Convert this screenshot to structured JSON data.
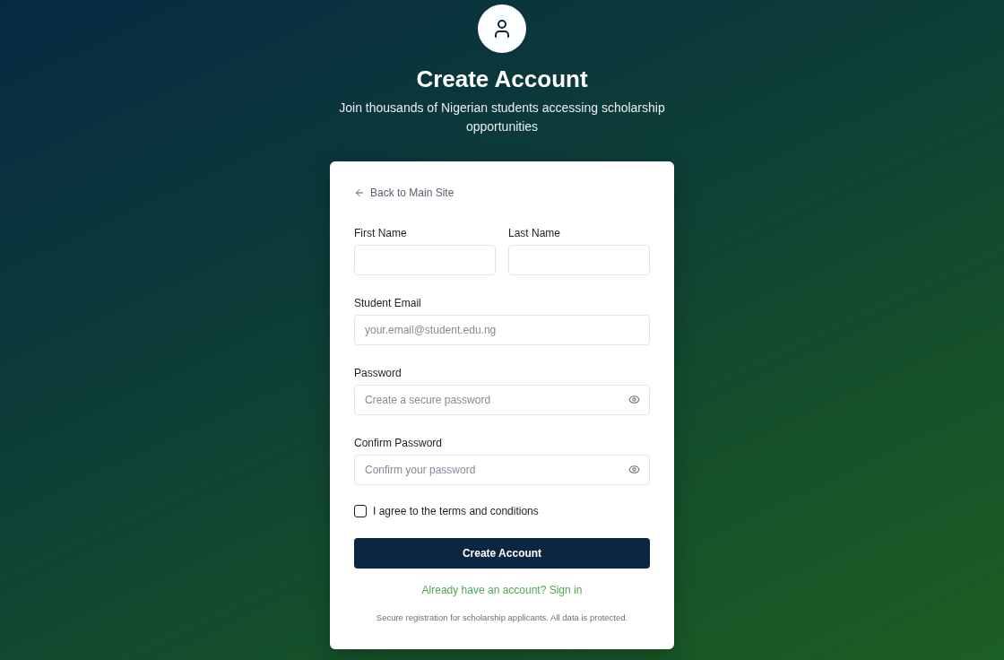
{
  "header": {
    "title": "Create Account",
    "subtitle": "Join thousands of Nigerian students accessing scholarship opportunities"
  },
  "form": {
    "back_link": "Back to Main Site",
    "rows": [
      [
        {
          "label": "First Name",
          "kind": "text"
        },
        {
          "label": "Last Name",
          "kind": "text"
        }
      ],
      [
        {
          "label": "Student Email",
          "kind": "email",
          "placeholder": "your.email@student.edu.ng"
        }
      ],
      [
        {
          "label": "Password",
          "kind": "password",
          "placeholder": "Create a secure password"
        }
      ],
      [
        {
          "label": "Confirm Password",
          "kind": "password",
          "placeholder": "Confirm your password"
        }
      ]
    ],
    "agreement": {
      "label": "I agree to the terms and conditions",
      "checked": false
    },
    "submit": "Create Account",
    "sign_in_link": "Already have an account? Sign in",
    "footer_note": "Secure registration for scholarship applicants. All data is protected."
  }
}
